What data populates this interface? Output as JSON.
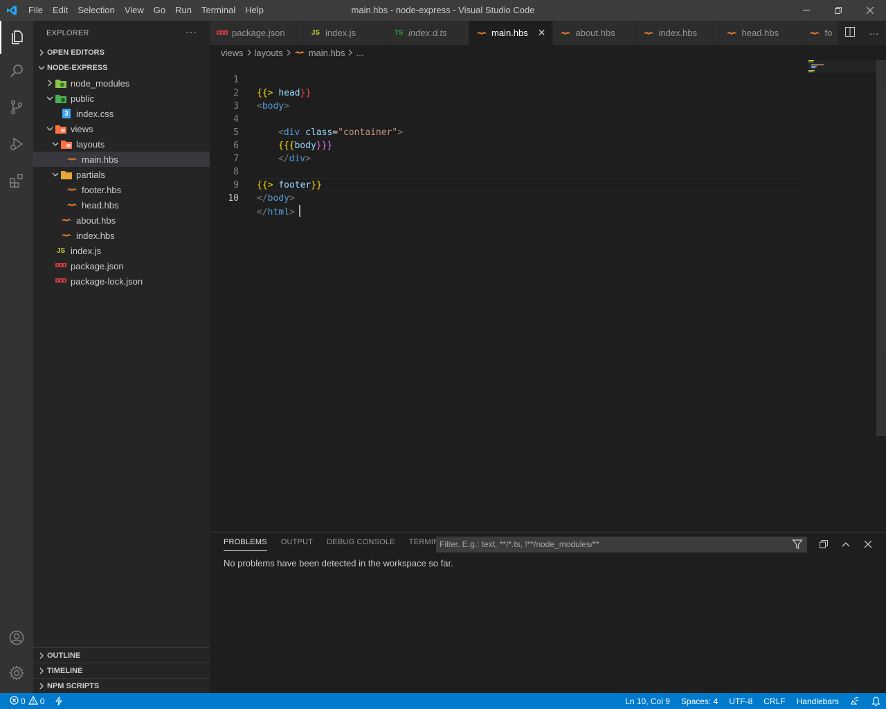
{
  "titlebar": {
    "title": "main.hbs - node-express - Visual Studio Code",
    "menu": [
      "File",
      "Edit",
      "Selection",
      "View",
      "Go",
      "Run",
      "Terminal",
      "Help"
    ]
  },
  "sidebar": {
    "header": "EXPLORER",
    "more": "···",
    "open_editors": "OPEN EDITORS",
    "project": "NODE-EXPRESS",
    "tree": {
      "node_modules": "node_modules",
      "public": "public",
      "index_css": "index.css",
      "views": "views",
      "layouts": "layouts",
      "main_hbs": "main.hbs",
      "partials": "partials",
      "footer_hbs": "footer.hbs",
      "head_hbs": "head.hbs",
      "about_hbs": "about.hbs",
      "index_hbs": "index.hbs",
      "index_js": "index.js",
      "package_json": "package.json",
      "package_lock_json": "package-lock.json"
    },
    "outline": "OUTLINE",
    "timeline": "TIMELINE",
    "npm_scripts": "NPM SCRIPTS"
  },
  "tabs": {
    "t1": "package.json",
    "t2": "index.js",
    "t3": "index.d.ts",
    "t4": "main.hbs",
    "t5": "about.hbs",
    "t6": "index.hbs",
    "t7": "head.hbs",
    "t8": "fo",
    "close": "✕"
  },
  "icons": {
    "js": "JS",
    "ts": "TS",
    "css": "3"
  },
  "breadcrumb": {
    "b1": "views",
    "b2": "layouts",
    "b3": "main.hbs",
    "b4": "..."
  },
  "editor": {
    "line_numbers": [
      "1",
      "2",
      "3",
      "4",
      "5",
      "6",
      "7",
      "8",
      "9",
      "10"
    ],
    "code": {
      "l1_open": "{{",
      "l1_gt": ">",
      "l1_name": "head",
      "l1_close": "}}",
      "l2_lt": "<",
      "l2_tag": "body",
      "l2_gt": ">",
      "l4_lt": "<",
      "l4_tag": "div",
      "l4_attr": "class",
      "l4_eq": "=",
      "l4_val": "\"container\"",
      "l4_gt": ">",
      "l5_open": "{{{",
      "l5_name": "body",
      "l5_close": "}}}",
      "l6_lt": "</",
      "l6_tag": "div",
      "l6_gt": ">",
      "l8_open": "{{",
      "l8_gt": ">",
      "l8_name": "footer",
      "l8_close": "}}",
      "l9_lt": "</",
      "l9_tag": "body",
      "l9_gt": ">",
      "l10_lt": "</",
      "l10_tag": "html",
      "l10_gt": ">"
    }
  },
  "panel": {
    "tabs": {
      "problems": "PROBLEMS",
      "output": "OUTPUT",
      "debug": "DEBUG CONSOLE",
      "terminal": "TERMINAL"
    },
    "filter_placeholder": "Filter. E.g.: text, **/*.ts, !**/node_modules/**",
    "message": "No problems have been detected in the workspace so far."
  },
  "statusbar": {
    "errors": "0",
    "warnings": "0",
    "position": "Ln 10, Col 9",
    "spaces": "Spaces: 4",
    "encoding": "UTF-8",
    "eol": "CRLF",
    "language": "Handlebars"
  },
  "colors": {
    "accent": "#007acc",
    "tag": "#569cd6",
    "punct": "#808080",
    "attr": "#9cdcfe",
    "string": "#ce9178",
    "brace_yellow": "#ffd700",
    "brace_red": "#f44747",
    "brace_purple": "#da70d6",
    "hbs_icon": "#e37933",
    "js_icon": "#cbcb41",
    "ts_icon": "#2a9d3a",
    "json_icon": "#cc3e44",
    "css_icon": "#42a5f5"
  }
}
